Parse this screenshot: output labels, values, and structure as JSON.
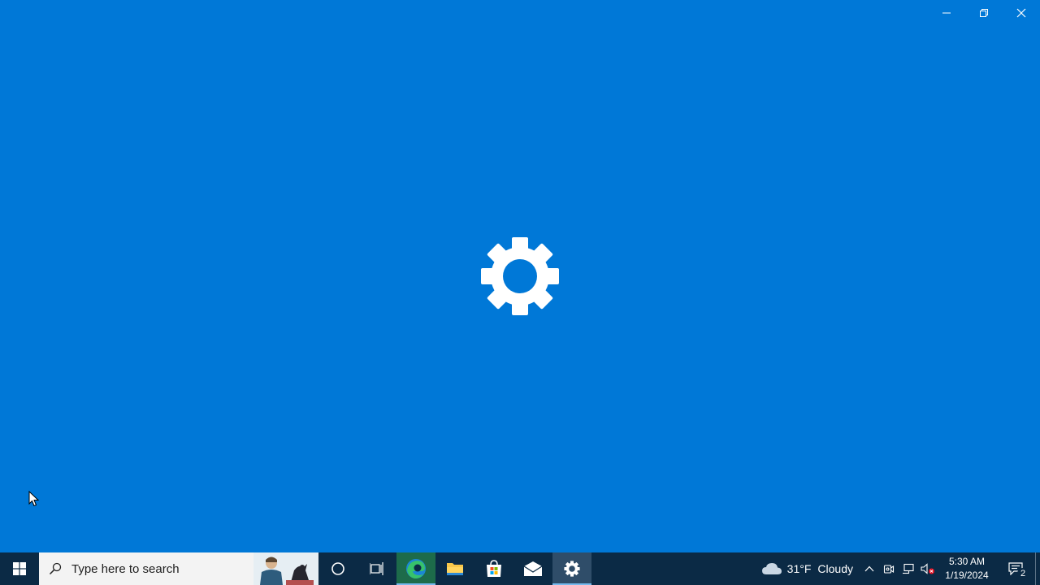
{
  "colors": {
    "splash_background": "#0078d7",
    "taskbar_background": "#0b2a45",
    "search_background": "#f3f3f3"
  },
  "window": {
    "app_icon": "settings-gear-icon",
    "caption_icons": [
      "minimize-icon",
      "restore-icon",
      "close-icon"
    ]
  },
  "taskbar": {
    "search_placeholder": "Type here to search",
    "apps": [
      {
        "name": "cortana",
        "icon": "cortana-icon"
      },
      {
        "name": "task-view",
        "icon": "task-view-icon"
      },
      {
        "name": "edge",
        "icon": "edge-icon",
        "running": true
      },
      {
        "name": "file-explorer",
        "icon": "folder-icon",
        "running": true
      },
      {
        "name": "microsoft-store",
        "icon": "store-icon"
      },
      {
        "name": "mail",
        "icon": "mail-icon"
      },
      {
        "name": "settings",
        "icon": "settings-gear-icon",
        "running": true,
        "active": true
      }
    ],
    "weather": {
      "icon": "cloud-icon",
      "temperature": "31°F",
      "condition": "Cloudy"
    },
    "tray_icons": [
      "chevron-up-icon",
      "meet-now-icon",
      "network-icon",
      "volume-muted-icon"
    ],
    "clock": {
      "time": "5:30 AM",
      "date": "1/19/2024"
    },
    "notifications": {
      "count": "2"
    }
  }
}
